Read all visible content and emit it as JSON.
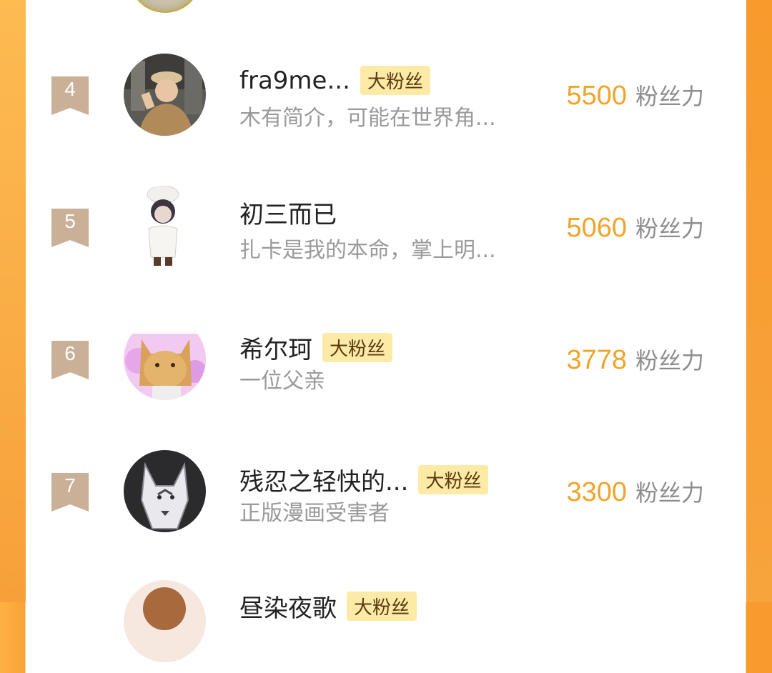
{
  "ranking": {
    "score_unit": "粉丝力",
    "colors": {
      "score": "#f0a42a",
      "badge_bg": "#fdeaa6",
      "rank_ribbon": "#c9b097",
      "side_gradient": "#f9a238"
    },
    "entries": [
      {
        "rank": "4",
        "name": "fra9me...",
        "badge": "大粉丝",
        "bio": "木有简介，可能在世界角...",
        "score": "5500",
        "avatar_icon": "child-photo-avatar"
      },
      {
        "rank": "5",
        "name": "初三而已",
        "badge": "",
        "bio": "扎卡是我的本命，掌上明...",
        "score": "5060",
        "avatar_icon": "chef-figure-avatar"
      },
      {
        "rank": "6",
        "name": "希尔珂",
        "badge": "大粉丝",
        "bio": "一位父亲",
        "score": "3778",
        "avatar_icon": "cat-meme-avatar"
      },
      {
        "rank": "7",
        "name": "残忍之轻快的...",
        "badge": "大粉丝",
        "bio": "正版漫画受害者",
        "score": "3300",
        "avatar_icon": "wolf-drawing-avatar"
      },
      {
        "rank": "",
        "name": "昼染夜歌",
        "badge": "大粉丝",
        "bio": "",
        "score": "",
        "avatar_icon": "anime-girl-avatar"
      }
    ]
  }
}
